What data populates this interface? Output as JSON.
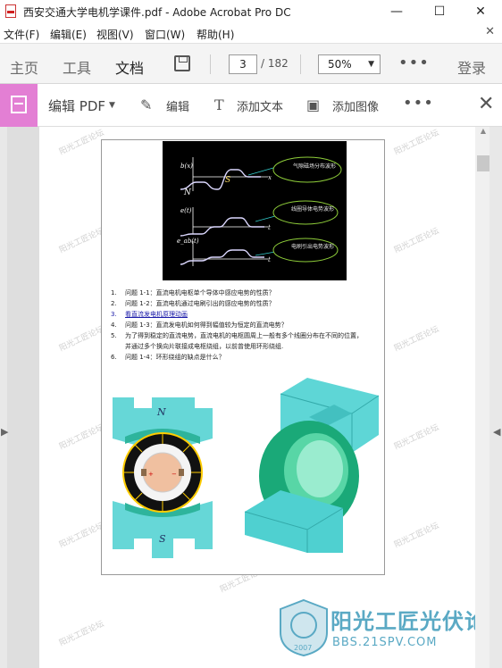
{
  "window": {
    "title": "西安交通大学电机学课件.pdf - Adobe Acrobat Pro DC",
    "minimize": "—",
    "maximize": "☐",
    "close": "✕"
  },
  "menu": {
    "items": [
      "文件(F)",
      "编辑(E)",
      "视图(V)",
      "窗口(W)",
      "帮助(H)"
    ],
    "close_doc": "✕"
  },
  "toolbar": {
    "tabs": [
      "主页",
      "工具",
      "文档"
    ],
    "active_tab": "文档",
    "page_current": "3",
    "page_total": "/ 182",
    "zoom": "50%",
    "more": "•••",
    "login": "登录"
  },
  "edit_toolbar": {
    "edit_pdf": "编辑 PDF",
    "edit": "编辑",
    "add_text": "添加文本",
    "add_image": "添加图像",
    "more": "•••"
  },
  "slide": {
    "scope_labels": {
      "b": "b(x)",
      "e": "e(t)",
      "eab": "e_ab(t)",
      "bubble1": "气隙磁场分布波形",
      "bubble2": "线圈导体电势波形",
      "bubble3": "电刷引出电势波形",
      "n_pole": "N",
      "s_pole": "S",
      "x_axis": "x",
      "t_axis": "t"
    },
    "questions": [
      {
        "n": "1.",
        "text": "问题 1-1：直流电机电枢单个导体中感应电势的性质？"
      },
      {
        "n": "2.",
        "text": "问题 1-2：直流电机通过电刷引出的感应电势的性质？"
      },
      {
        "n": "3.",
        "text": "看直流发电机原理动画",
        "link": true
      },
      {
        "n": "4.",
        "text": "问题 1-3：直流发电机如何得到幅值较为恒定的直流电势？"
      },
      {
        "n": "5.",
        "text": "为了得到稳定的直流电势，直流电机的电枢圆周上一般有多个线圈分布在不同的位置，"
      },
      {
        "n": "",
        "text": "并通过多个换向片联接成电枢绕组，以前曾使用环形绕组."
      },
      {
        "n": "6.",
        "text": "问题 1-4：环形绕组的缺点是什么？"
      }
    ],
    "machine_labels": {
      "north": "N",
      "south": "S"
    }
  },
  "watermark": {
    "text": "阳光工匠论坛",
    "brand": "阳光工匠光伏论坛",
    "url": "BBS.21SPV.COM",
    "year": "2007"
  }
}
